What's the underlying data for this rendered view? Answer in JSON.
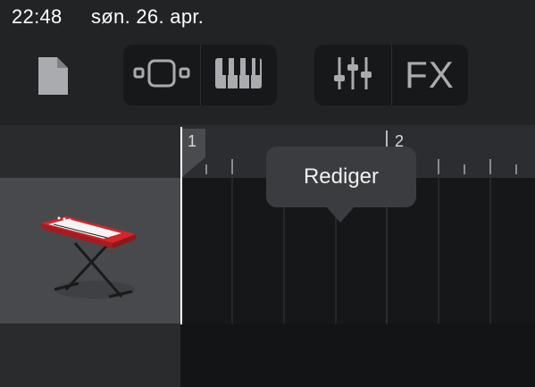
{
  "status": {
    "time": "22:48",
    "date": "søn. 26. apr."
  },
  "toolbar": {
    "document_icon": "document-icon",
    "view_group": [
      {
        "icon": "tracks-view-icon"
      },
      {
        "icon": "piano-keys-icon"
      }
    ],
    "mix_group": [
      {
        "icon": "mixer-sliders-icon"
      },
      {
        "label": "FX"
      }
    ]
  },
  "ruler": {
    "bars": [
      "1",
      "2"
    ]
  },
  "tooltip": {
    "label": "Rediger"
  },
  "track": {
    "instrument_icon": "keyboard-instrument-icon"
  },
  "colors": {
    "accent_red": "#d2262b",
    "playhead": "#ffffff",
    "icon_gray": "#a9abae"
  }
}
